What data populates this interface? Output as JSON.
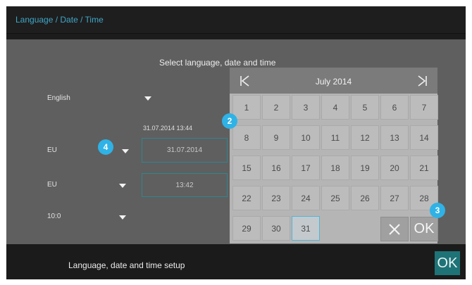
{
  "header": {
    "title": "Language / Date / Time"
  },
  "main": {
    "section_title": "Select language, date and time",
    "language": {
      "value": "English"
    },
    "date_format": {
      "value": "EU"
    },
    "time_format": {
      "value": "EU"
    },
    "value_row": {
      "value": "10:0"
    },
    "datetime_readout": "31.07.2014 13:44",
    "date_field": {
      "value": "31.07.2014"
    },
    "time_field": {
      "value": "13:42"
    }
  },
  "calendar": {
    "month_label": "July 2014",
    "prev_icon": "skip-back-icon",
    "next_icon": "skip-forward-icon",
    "days": [
      "1",
      "2",
      "3",
      "4",
      "5",
      "6",
      "7",
      "8",
      "9",
      "10",
      "11",
      "12",
      "13",
      "14",
      "15",
      "16",
      "17",
      "18",
      "19",
      "20",
      "21",
      "22",
      "23",
      "24",
      "25",
      "26",
      "27",
      "28",
      "29",
      "30",
      "31"
    ],
    "selected_day": "31",
    "cancel_icon": "close-icon",
    "ok_label": "OK"
  },
  "footer": {
    "label": "Language, date and time setup",
    "ok_label": "OK"
  },
  "badges": [
    "2",
    "3",
    "4"
  ],
  "colors": {
    "accent": "#2fb2e6",
    "ok_button": "#1e7377",
    "header_text": "#3fa7c8"
  }
}
